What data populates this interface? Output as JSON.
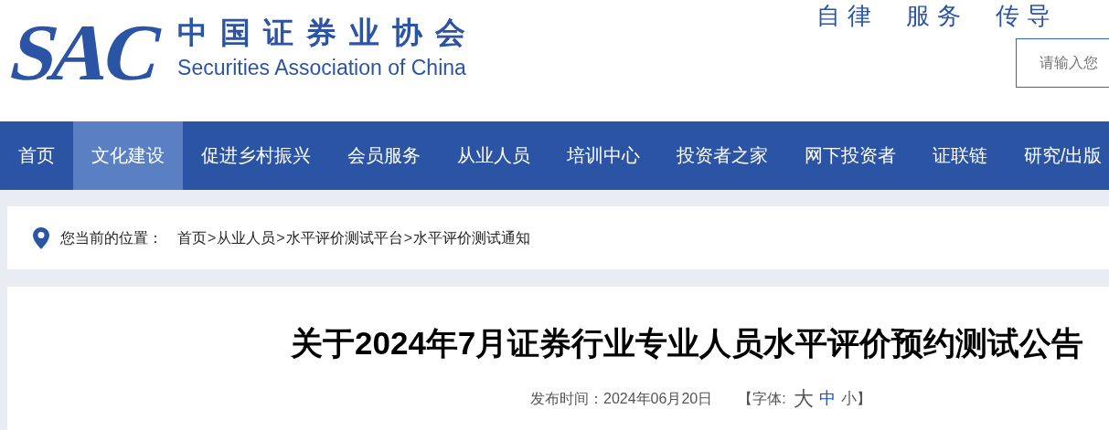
{
  "logo": {
    "mark": "SAC",
    "name_cn": "中国证券业协会",
    "name_en": "Securities Association of China"
  },
  "slogan": [
    "自律",
    "服务",
    "传导"
  ],
  "search": {
    "placeholder": "请输入您"
  },
  "nav": [
    {
      "label": "首页",
      "selected": false
    },
    {
      "label": "文化建设",
      "selected": true
    },
    {
      "label": "促进乡村振兴",
      "selected": false
    },
    {
      "label": "会员服务",
      "selected": false
    },
    {
      "label": "从业人员",
      "selected": false
    },
    {
      "label": "培训中心",
      "selected": false
    },
    {
      "label": "投资者之家",
      "selected": false
    },
    {
      "label": "网下投资者",
      "selected": false
    },
    {
      "label": "证联链",
      "selected": false
    },
    {
      "label": "研究/出版",
      "selected": false
    }
  ],
  "breadcrumb": {
    "label": "您当前的位置：",
    "items": [
      {
        "kind": "link",
        "text": "首页"
      },
      {
        "kind": "separator",
        "text": ">"
      },
      {
        "kind": "link",
        "text": "从业人员"
      },
      {
        "kind": "separator",
        "text": ">"
      },
      {
        "kind": "link",
        "text": "水平评价测试平台"
      },
      {
        "kind": "separator",
        "text": ">"
      },
      {
        "kind": "link",
        "text": "水平评价测试通知"
      }
    ]
  },
  "article": {
    "title": "关于2024年7月证券行业专业人员水平评价预约测试公告",
    "date_label": "发布时间：",
    "date": "2024年06月20日",
    "font_size": {
      "open": "【字体:",
      "close": "】",
      "options": [
        {
          "label": "大",
          "selected": false
        },
        {
          "label": "中",
          "selected": true
        },
        {
          "label": "小",
          "selected": false
        }
      ]
    }
  }
}
